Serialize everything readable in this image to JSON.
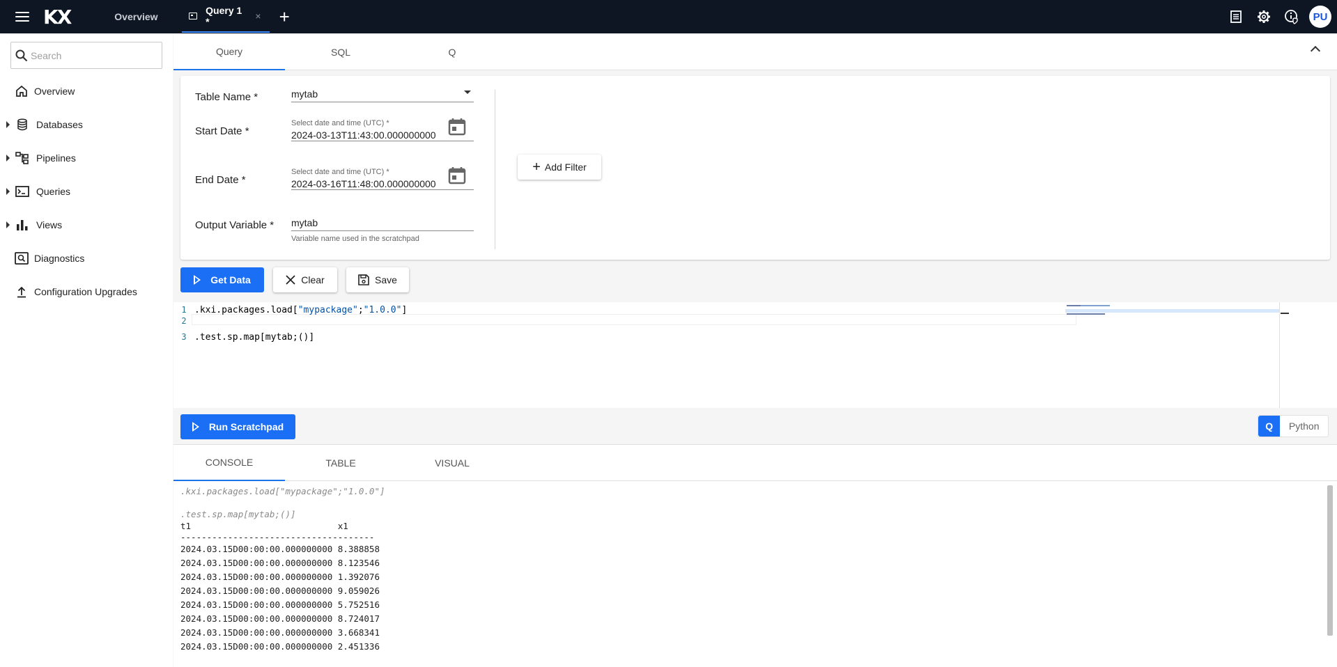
{
  "topbar": {
    "logo": "KX",
    "tabs": [
      {
        "label": "Overview"
      },
      {
        "label": "Query 1 *",
        "close": "×"
      }
    ],
    "add_tab": "+",
    "avatar_initials": "PU"
  },
  "sidebar": {
    "search_placeholder": "Search",
    "items": [
      {
        "label": "Overview",
        "icon": "home-icon"
      },
      {
        "label": "Databases",
        "icon": "database-icon"
      },
      {
        "label": "Pipelines",
        "icon": "pipeline-icon"
      },
      {
        "label": "Queries",
        "icon": "terminal-icon"
      },
      {
        "label": "Views",
        "icon": "bar-chart-icon"
      },
      {
        "label": "Diagnostics",
        "icon": "diagnostics-icon"
      },
      {
        "label": "Configuration Upgrades",
        "icon": "upload-icon"
      }
    ]
  },
  "query_tabs": [
    {
      "label": "Query"
    },
    {
      "label": "SQL"
    },
    {
      "label": "Q"
    }
  ],
  "form": {
    "table_name": {
      "label": "Table Name *",
      "value": "mytab"
    },
    "start_date": {
      "label": "Start Date *",
      "hint": "Select date and time (UTC) *",
      "value": "2024-03-13T11:43:00.000000000"
    },
    "end_date": {
      "label": "End Date *",
      "hint": "Select date and time (UTC) *",
      "value": "2024-03-16T11:48:00.000000000"
    },
    "output_variable": {
      "label": "Output Variable *",
      "value": "mytab",
      "helper": "Variable name used in the scratchpad"
    },
    "add_filter": "Add Filter"
  },
  "actions": {
    "get_data": "Get Data",
    "clear": "Clear",
    "save": "Save",
    "run_scratchpad": "Run Scratchpad"
  },
  "editor": {
    "lines": [
      {
        "num": "1",
        "prefix": ".kxi.packages.load[",
        "str1": "\"mypackage\"",
        "sep": ";",
        "str2": "\"1.0.0\"",
        "suffix": "]"
      },
      {
        "num": "2",
        "text": ""
      },
      {
        "num": "3",
        "text": ".test.sp.map[mytab;()]"
      }
    ]
  },
  "language_toggle": {
    "q": "Q",
    "python": "Python",
    "selected": "Q"
  },
  "result_tabs": [
    {
      "label": "CONSOLE"
    },
    {
      "label": "TABLE"
    },
    {
      "label": "VISUAL"
    }
  ],
  "console": {
    "echo1": ".kxi.packages.load[\"mypackage\";\"1.0.0\"]",
    "echo2": ".test.sp.map[mytab;()]",
    "header": "t1                            x1",
    "separator": "-------------------------------------",
    "rows": [
      "2024.03.15D00:00:00.000000000 8.388858",
      "2024.03.15D00:00:00.000000000 8.123546",
      "2024.03.15D00:00:00.000000000 1.392076",
      "2024.03.15D00:00:00.000000000 9.059026",
      "2024.03.15D00:00:00.000000000 5.752516",
      "2024.03.15D00:00:00.000000000 8.724017",
      "2024.03.15D00:00:00.000000000 3.668341",
      "2024.03.15D00:00:00.000000000 2.451336"
    ]
  },
  "colors": {
    "accent": "#1a6ff5",
    "topbar": "#0f1623"
  }
}
